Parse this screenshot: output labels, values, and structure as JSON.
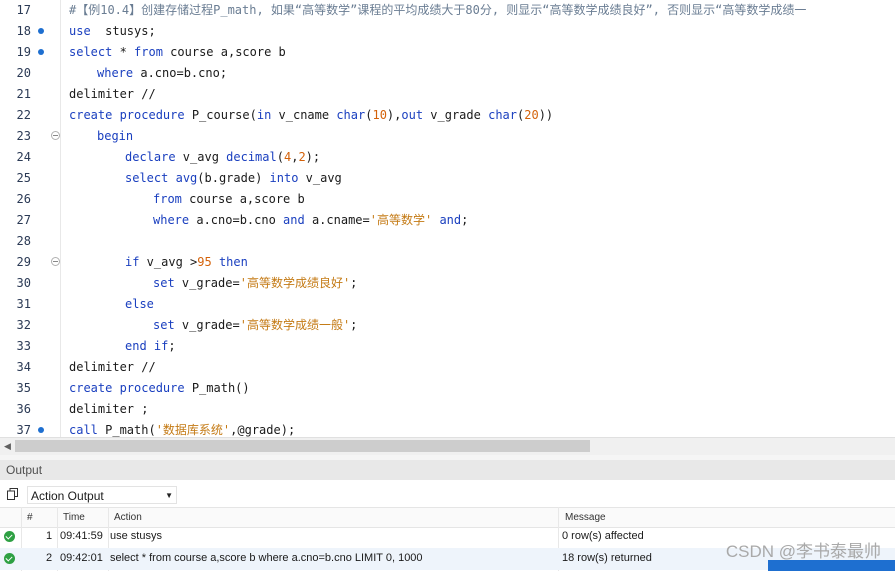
{
  "editor": {
    "lines": [
      {
        "n": "17",
        "marker": false,
        "fold": false,
        "indent": 0,
        "tokens": [
          [
            "cmt",
            "#【例10.4】创建存储过程P_math, 如果“高等数学”课程的平均成绩大于80分, 则显示“高等数学成绩良好”, 否则显示“高等数学成绩一"
          ]
        ]
      },
      {
        "n": "18",
        "marker": true,
        "fold": false,
        "indent": 0,
        "tokens": [
          [
            "kw",
            "use"
          ],
          [
            "",
            "  stusys;"
          ]
        ]
      },
      {
        "n": "19",
        "marker": true,
        "fold": false,
        "indent": 0,
        "tokens": [
          [
            "kw",
            "select"
          ],
          [
            "",
            " * "
          ],
          [
            "kw",
            "from"
          ],
          [
            "",
            " course a,score b"
          ]
        ]
      },
      {
        "n": "20",
        "marker": false,
        "fold": false,
        "indent": 1,
        "tokens": [
          [
            "kw",
            "where"
          ],
          [
            "",
            " a.cno=b.cno;"
          ]
        ]
      },
      {
        "n": "21",
        "marker": false,
        "fold": false,
        "indent": 0,
        "tokens": [
          [
            "",
            "delimiter //"
          ]
        ]
      },
      {
        "n": "22",
        "marker": false,
        "fold": false,
        "indent": 0,
        "tokens": [
          [
            "kw",
            "create procedure"
          ],
          [
            "",
            " P_course("
          ],
          [
            "kw",
            "in"
          ],
          [
            "",
            " v_cname "
          ],
          [
            "kw",
            "char"
          ],
          [
            "",
            "("
          ],
          [
            "num",
            "10"
          ],
          [
            "",
            "),"
          ],
          [
            "kw",
            "out"
          ],
          [
            "",
            " v_grade "
          ],
          [
            "kw",
            "char"
          ],
          [
            "",
            "("
          ],
          [
            "num",
            "20"
          ],
          [
            "",
            "))"
          ]
        ]
      },
      {
        "n": "23",
        "marker": false,
        "fold": true,
        "indent": 1,
        "tokens": [
          [
            "kw",
            "begin"
          ]
        ]
      },
      {
        "n": "24",
        "marker": false,
        "fold": false,
        "indent": 2,
        "tokens": [
          [
            "kw",
            "declare"
          ],
          [
            "",
            " v_avg "
          ],
          [
            "kw",
            "decimal"
          ],
          [
            "",
            "("
          ],
          [
            "num",
            "4"
          ],
          [
            "",
            ","
          ],
          [
            "num",
            "2"
          ],
          [
            "",
            ");"
          ]
        ]
      },
      {
        "n": "25",
        "marker": false,
        "fold": false,
        "indent": 2,
        "tokens": [
          [
            "kw",
            "select"
          ],
          [
            "",
            " "
          ],
          [
            "kw",
            "avg"
          ],
          [
            "",
            "(b.grade) "
          ],
          [
            "kw",
            "into"
          ],
          [
            "",
            " v_avg"
          ]
        ]
      },
      {
        "n": "26",
        "marker": false,
        "fold": false,
        "indent": 3,
        "tokens": [
          [
            "kw",
            "from"
          ],
          [
            "",
            " course a,score b"
          ]
        ]
      },
      {
        "n": "27",
        "marker": false,
        "fold": false,
        "indent": 3,
        "tokens": [
          [
            "kw",
            "where"
          ],
          [
            "",
            " a.cno=b.cno "
          ],
          [
            "kw",
            "and"
          ],
          [
            "",
            " a.cname="
          ],
          [
            "str",
            "'高等数学'"
          ],
          [
            "",
            " "
          ],
          [
            "kw",
            "and"
          ],
          [
            "",
            ";"
          ]
        ]
      },
      {
        "n": "28",
        "marker": false,
        "fold": false,
        "indent": 0,
        "tokens": []
      },
      {
        "n": "29",
        "marker": false,
        "fold": true,
        "indent": 2,
        "tokens": [
          [
            "kw",
            "if"
          ],
          [
            "",
            " v_avg >"
          ],
          [
            "num",
            "95"
          ],
          [
            "",
            " "
          ],
          [
            "kw",
            "then"
          ]
        ]
      },
      {
        "n": "30",
        "marker": false,
        "fold": false,
        "indent": 3,
        "tokens": [
          [
            "kw",
            "set"
          ],
          [
            "",
            " v_grade="
          ],
          [
            "str",
            "'高等数学成绩良好'"
          ],
          [
            "",
            ";"
          ]
        ]
      },
      {
        "n": "31",
        "marker": false,
        "fold": false,
        "indent": 2,
        "tokens": [
          [
            "kw",
            "else"
          ]
        ]
      },
      {
        "n": "32",
        "marker": false,
        "fold": false,
        "indent": 3,
        "tokens": [
          [
            "kw",
            "set"
          ],
          [
            "",
            " v_grade="
          ],
          [
            "str",
            "'高等数学成绩一般'"
          ],
          [
            "",
            ";"
          ]
        ]
      },
      {
        "n": "33",
        "marker": false,
        "fold": false,
        "indent": 2,
        "tokens": [
          [
            "kw",
            "end if"
          ],
          [
            "",
            ";"
          ]
        ]
      },
      {
        "n": "34",
        "marker": false,
        "fold": false,
        "indent": 0,
        "tokens": [
          [
            "",
            "delimiter //"
          ]
        ]
      },
      {
        "n": "35",
        "marker": false,
        "fold": false,
        "indent": 0,
        "tokens": [
          [
            "kw",
            "create procedure"
          ],
          [
            "",
            " P_math()"
          ]
        ]
      },
      {
        "n": "36",
        "marker": false,
        "fold": false,
        "indent": 0,
        "tokens": [
          [
            "",
            "delimiter ;"
          ]
        ]
      },
      {
        "n": "37",
        "marker": true,
        "fold": false,
        "indent": 0,
        "tokens": [
          [
            "kw",
            "call"
          ],
          [
            "",
            " P_math("
          ],
          [
            "str",
            "'数据库系统'"
          ],
          [
            "",
            ",@grade);"
          ]
        ]
      }
    ]
  },
  "output": {
    "title": "Output",
    "selector_value": "Action Output",
    "columns": [
      "#",
      "Time",
      "Action",
      "Message"
    ],
    "rows": [
      {
        "num": "1",
        "time": "09:41:59",
        "action": "use stusys",
        "message": "0 row(s) affected"
      },
      {
        "num": "2",
        "time": "09:42:01",
        "action": "select * from course a,score b where a.cno=b.cno LIMIT 0, 1000",
        "message": "18 row(s) returned"
      }
    ]
  },
  "watermark": "CSDN @李书泰最帅",
  "colors": {
    "keyword": "#1a3fbf",
    "number": "#d4620a",
    "string": "#c47a14",
    "marker": "#1e6fd0",
    "ok": "#2ea043"
  }
}
